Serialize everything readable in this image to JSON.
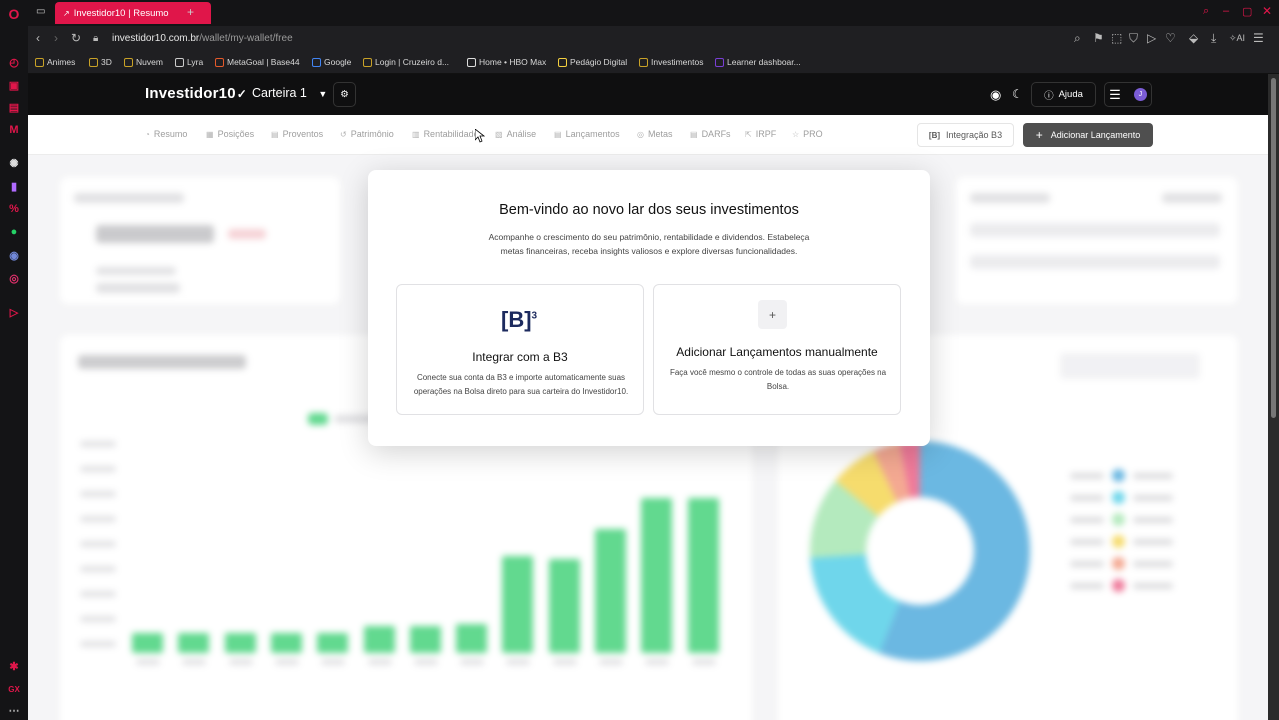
{
  "browser": {
    "tab_title": "Investidor10 | Resumo",
    "new_tab": "+",
    "url_domain": "investidor10.com.br",
    "url_path": "/wallet/my-wallet/free",
    "ai_label": "AI",
    "bookmarks": [
      "Animes",
      "3D",
      "Nuvem",
      "Lyra",
      "MetaGoal | Base44",
      "Google",
      "Login | Cruzeiro d...",
      "Home • HBO Max",
      "Pedágio Digital",
      "Investimentos",
      "Learner dashboar..."
    ]
  },
  "header": {
    "logo": "Investidor10",
    "wallet_name": "Carteira 1",
    "help_label": "Ajuda",
    "avatar_letter": "J"
  },
  "subnav": {
    "items": [
      "Resumo",
      "Posições",
      "Proventos",
      "Patrimônio",
      "Rentabilidade",
      "Análise",
      "Lançamentos",
      "Metas",
      "DARFs",
      "IRPF",
      "PRO"
    ],
    "b3_button": "Integração B3",
    "add_button": "Adicionar Lançamento"
  },
  "modal": {
    "title": "Bem-vindo ao novo lar dos seus investimentos",
    "subtitle": "Acompanhe o crescimento do seu patrimônio, rentabilidade e dividendos. Estabeleça metas financeiras, receba insights valiosos e explore diversas funcionalidades.",
    "b3_logo": "[B]",
    "b3_logo_sup": "3",
    "option_b3": {
      "title": "Integrar com a B3",
      "description": "Conecte sua conta da B3 e importe automaticamente suas operações na Bolsa direto para sua carteira do Investidor10."
    },
    "option_manual": {
      "plus": "+",
      "title": "Adicionar Lançamentos manualmente",
      "description": "Faça você mesmo o controle de todas as suas operações na Bolsa."
    }
  },
  "background": {
    "bar_heights": [
      0.11,
      0.11,
      0.11,
      0.11,
      0.11,
      0.15,
      0.15,
      0.16,
      0.54,
      0.52,
      0.69,
      0.86,
      0.86
    ],
    "donut": [
      {
        "value": 0.56,
        "color": "#3aa0d8"
      },
      {
        "value": 0.18,
        "color": "#3fc9e4"
      },
      {
        "value": 0.12,
        "color": "#9be3a8"
      },
      {
        "value": 0.07,
        "color": "#f3d03d"
      },
      {
        "value": 0.04,
        "color": "#f08c6e"
      },
      {
        "value": 0.03,
        "color": "#ea4e79"
      }
    ],
    "legend_colors": [
      "#3aa0d8",
      "#3fc9e4",
      "#9be3a8",
      "#f3d03d",
      "#f08c6e",
      "#ea4e79"
    ]
  },
  "colors": {
    "accent": "#e0164a",
    "bar_green": "#2ecc6a",
    "page_bg": "#f2f2f4",
    "nav_bg": "#0f0f10"
  }
}
